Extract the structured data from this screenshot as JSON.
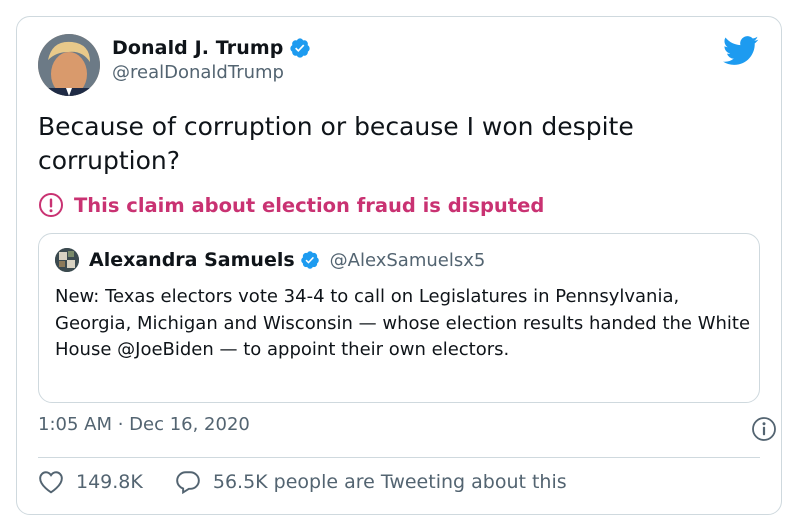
{
  "author": {
    "name": "Donald J. Trump",
    "handle": "@realDonaldTrump"
  },
  "tweet": {
    "text": "Because of corruption or because I won despite corruption?"
  },
  "notice": {
    "text": "This claim about election fraud is disputed",
    "color": "#c93272"
  },
  "quote": {
    "name": "Alexandra Samuels",
    "handle": "@AlexSamuelsx5",
    "text": "New: Texas electors vote 34-4 to call on Legislatures in Pennsylvania, Georgia, Michigan and Wisconsin — whose election results handed the White House @JoeBiden — to appoint their own electors."
  },
  "timestamp": {
    "text": "1:05 AM · Dec 16, 2020"
  },
  "actions": {
    "likes": "149.8K",
    "conversation": "56.5K people are Tweeting about this"
  },
  "colors": {
    "brand_blue": "#1d9bf0",
    "secondary_text": "#536471",
    "border": "#cfd9de"
  },
  "icons": {
    "verified": "verified-badge-icon",
    "twitter": "twitter-bird-icon",
    "warning": "exclamation-circle-icon",
    "info": "info-icon",
    "heart": "heart-icon",
    "reply": "speech-bubble-icon"
  }
}
